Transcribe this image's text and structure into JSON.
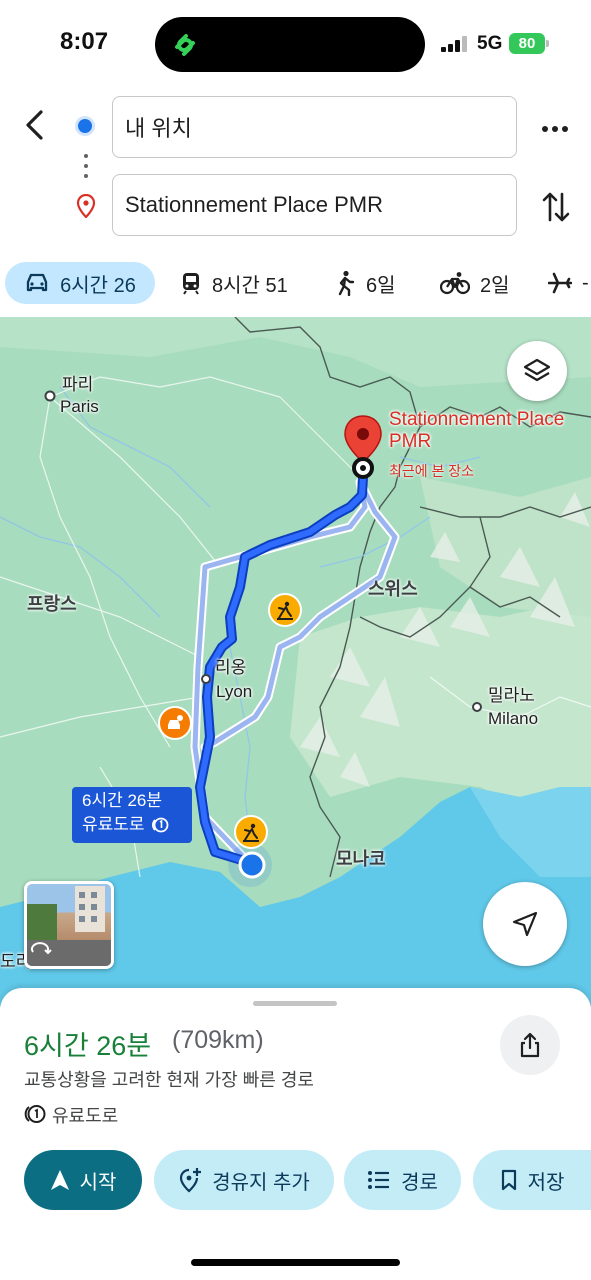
{
  "status_bar": {
    "time": "8:07",
    "network": "5G",
    "battery": "80"
  },
  "search": {
    "origin": "내 위치",
    "destination": "Stationnement Place PMR"
  },
  "travel_modes": [
    {
      "mode": "drive",
      "label": "6시간 26",
      "active": true
    },
    {
      "mode": "transit",
      "label": "8시간 51",
      "active": false
    },
    {
      "mode": "walk",
      "label": "6일",
      "active": false
    },
    {
      "mode": "bike",
      "label": "2일",
      "active": false
    },
    {
      "mode": "flight",
      "label": "-",
      "active": false
    }
  ],
  "map": {
    "labels": {
      "paris_ko": "파리",
      "paris": "Paris",
      "france": "프랑스",
      "lyon_ko": "리옹",
      "lyon": "Lyon",
      "switzerland": "스위스",
      "milano_ko": "밀라노",
      "milano": "Milano",
      "monaco": "모나코",
      "edge": "도리"
    },
    "destination_label": "Stationnement Place PMR",
    "destination_sub": "최근에 본 장소",
    "route_tag_time": "6시간 26분",
    "route_tag_toll": "유료도로"
  },
  "sheet": {
    "eta": "6시간 26분",
    "distance": "(709km)",
    "subtitle": "교통상황을 고려한 현재 가장 빠른 경로",
    "toll": "유료도로",
    "buttons": {
      "start": "시작",
      "add_stop": "경유지 추가",
      "steps": "경로",
      "save": "저장"
    }
  },
  "colors": {
    "accent": "#1a73e8",
    "route": "#1a56d6",
    "eta_green": "#188038",
    "start_button": "#0b6e82",
    "light_button": "#c3ecf7",
    "active_tab": "#c3e7ff"
  }
}
